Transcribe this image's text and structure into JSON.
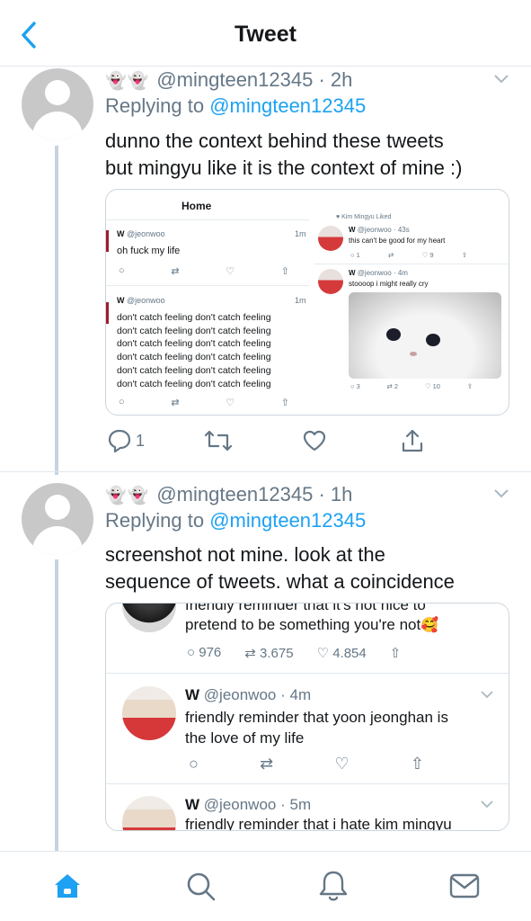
{
  "header": {
    "title": "Tweet"
  },
  "tweets": [
    {
      "emoji": "👻👻",
      "handle": "@mingteen12345",
      "time": "2h",
      "replying_prefix": "Replying to",
      "replying_to": "@mingteen12345",
      "text_lines": [
        "dunno the context behind these tweets",
        "but mingyu like it is the context of mine :)"
      ],
      "actions": {
        "reply_count": "1"
      }
    },
    {
      "emoji": "👻👻",
      "handle": "@mingteen12345",
      "time": "1h",
      "replying_prefix": "Replying to",
      "replying_to": "@mingteen12345",
      "text_lines": [
        "screenshot not mine. look at the",
        "sequence of tweets. what a coincidence"
      ]
    }
  ],
  "screenshot1": {
    "home_title": "Home",
    "left_tweet1": {
      "name": "W",
      "handle": "@jeonwoo",
      "time": "1m",
      "text": "oh fuck my life"
    },
    "left_tweet2": {
      "name": "W",
      "handle": "@jeonwoo",
      "time": "1m",
      "lines": [
        "don't catch feeling don't catch feeling",
        "don't catch feeling don't catch feeling",
        "don't catch feeling don't catch feeling",
        "don't catch feeling don't catch feeling",
        "don't catch feeling don't catch feeling",
        "don't catch feeling don't catch feeling"
      ]
    },
    "right_liked": "Kim Mingyu Liked",
    "right_tweet1": {
      "name": "W",
      "handle": "@jeonwoo · 43s",
      "text": "this can't be good for my heart",
      "c1": "1",
      "c2": "9"
    },
    "right_tweet2": {
      "name": "W",
      "handle": "@jeonwoo · 4m",
      "text": "stoooop i might really cry",
      "c1": "3",
      "c2": "2",
      "c3": "10"
    }
  },
  "screenshot2": {
    "top_line_partial": "friendly reminder that it's not nice to",
    "top_line2": "pretend to be something you're not",
    "top_emoji": "🥰",
    "top_counts": {
      "reply": "976",
      "retweet": "3.675",
      "like": "4.854"
    },
    "tweet_a": {
      "name": "W",
      "handle": "@jeonwoo",
      "time": "4m",
      "lines": [
        "friendly reminder that yoon jeonghan is",
        "the love of my life"
      ]
    },
    "tweet_b": {
      "name": "W",
      "handle": "@jeonwoo",
      "time": "5m",
      "text": "friendly reminder that i hate kim mingyu"
    }
  },
  "tabbar": {
    "items": [
      "home-icon",
      "search-icon",
      "notifications-icon",
      "messages-icon"
    ],
    "active_color": "#1da1f2"
  },
  "colors": {
    "accent": "#1da1f2",
    "secondary_text": "#657786",
    "thread_line": "#c6d3df"
  }
}
